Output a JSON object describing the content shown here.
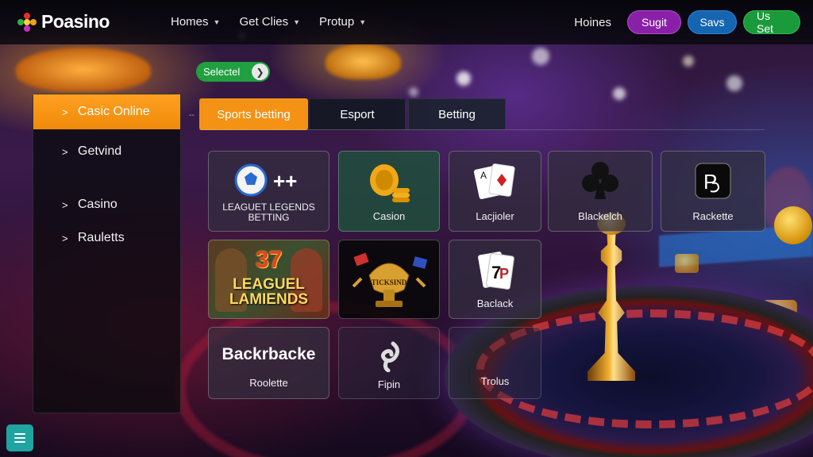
{
  "brand": {
    "logo_text": "Poasino"
  },
  "nav": {
    "items": [
      {
        "label": "Homes"
      },
      {
        "label": "Get Clies"
      },
      {
        "label": "Protup"
      }
    ],
    "right_link": "Hoines",
    "buttons": [
      {
        "label": "Sugit",
        "color": "#8a20a8"
      },
      {
        "label": "Savs",
        "color": "#1565b0"
      },
      {
        "label": "Us Set",
        "color": "#1a9a3a"
      }
    ]
  },
  "chip": {
    "label": "Selectel",
    "arrow_icon": "chevron-right-icon"
  },
  "sidebar": {
    "items": [
      {
        "label": "Casic Online",
        "active": true
      },
      {
        "label": "Getvind",
        "active": false
      },
      {
        "label": "Casino",
        "active": false
      },
      {
        "label": "Rauletts",
        "active": false
      }
    ]
  },
  "tabs": [
    {
      "label": "Sports betting",
      "active": true
    },
    {
      "label": "Esport",
      "active": false
    },
    {
      "label": "Betting",
      "active": false
    }
  ],
  "tiles": [
    {
      "label": "LEAGUET LEGENDS BETTING",
      "icon": "soccer-ball-plus-icon"
    },
    {
      "label": "Casion",
      "icon": "gold-coins-icon"
    },
    {
      "label": "Lacjioler",
      "icon": "playing-cards-icon"
    },
    {
      "label": "Blackelch",
      "icon": "club-suit-icon"
    },
    {
      "label": "Rackette",
      "icon": "p-logo-icon"
    },
    {
      "label": "LEAGUEL LAMIENDS",
      "badge": "37",
      "icon": "warriors-art-icon"
    },
    {
      "label": "",
      "icon": "trophy-art-icon",
      "banner": "TICKSIND"
    },
    {
      "label": "Baclack",
      "icon": "cards-7-icon"
    },
    {
      "label": "Roolette",
      "heading": "Backrbacke"
    },
    {
      "label": "Fipin",
      "icon": "spin-swirl-icon"
    },
    {
      "label": "Trolus"
    }
  ],
  "bottom_button": {
    "icon": "menu-icon"
  }
}
